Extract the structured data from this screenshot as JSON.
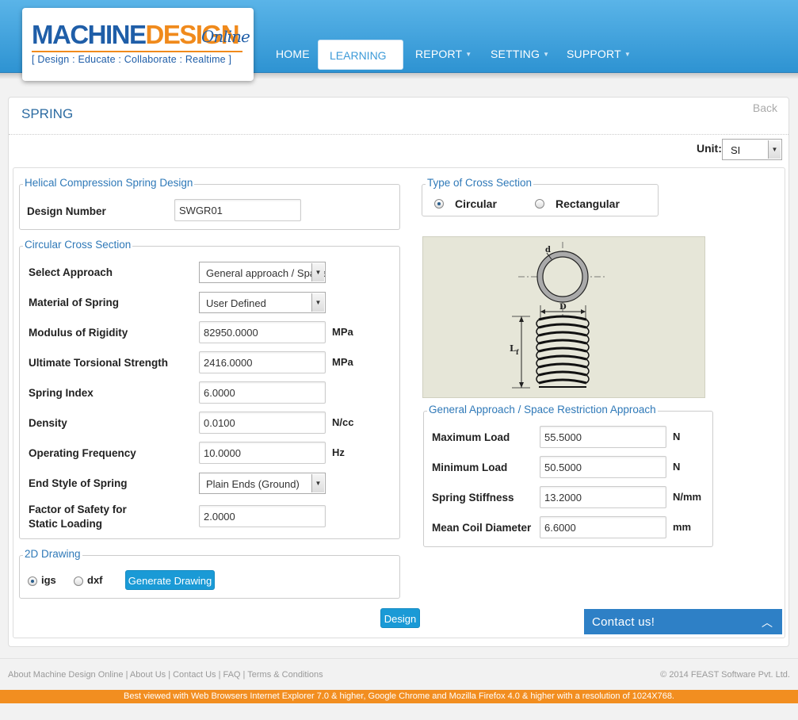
{
  "logo": {
    "main_part1": "MACHINE",
    "main_part2": "DESIGN",
    "suffix": "Online",
    "tagline": "[ Design : Educate : Collaborate : Realtime ]"
  },
  "nav": {
    "items": [
      {
        "label": "HOME",
        "has_dropdown": false
      },
      {
        "label": "LEARNING",
        "has_dropdown": false,
        "active": true
      },
      {
        "label": "REPORT",
        "has_dropdown": true
      },
      {
        "label": "SETTING",
        "has_dropdown": true
      },
      {
        "label": "SUPPORT",
        "has_dropdown": true
      }
    ],
    "caret_icon": "chevron-down-icon"
  },
  "page": {
    "title": "SPRING",
    "back": "Back",
    "unit_label": "Unit:",
    "unit_value": "SI"
  },
  "design_block": {
    "legend": "Helical Compression Spring Design",
    "design_number_label": "Design Number",
    "design_number_value": "SWGR01"
  },
  "circular": {
    "legend": "Circular Cross Section",
    "approach_label": "Select Approach",
    "approach_value": "General approach / Space Restriction Approach",
    "material_label": "Material of Spring",
    "material_value": "User Defined",
    "modulus_label": "Modulus of Rigidity",
    "modulus_value": "82950.0000",
    "modulus_unit": "MPa",
    "uts_label": "Ultimate Torsional Strength",
    "uts_value": "2416.0000",
    "uts_unit": "MPa",
    "index_label": "Spring Index",
    "index_value": "6.0000",
    "density_label": "Density",
    "density_value": "0.0100",
    "density_unit": "N/cc",
    "freq_label": "Operating Frequency",
    "freq_value": "10.0000",
    "freq_unit": "Hz",
    "end_label": "End Style of Spring",
    "end_value": "Plain Ends (Ground)",
    "fos_label_1": "Factor of Safety for",
    "fos_label_2": "Static Loading",
    "fos_value": "2.0000"
  },
  "drawing": {
    "legend": "2D Drawing",
    "opt_igs": "igs",
    "opt_dxf": "dxf",
    "selected": "igs",
    "generate_label": "Generate Drawing"
  },
  "cross_section": {
    "legend": "Type of Cross Section",
    "opt_circular": "Circular",
    "opt_rectangular": "Rectangular",
    "selected": "Circular"
  },
  "diagram": {
    "label_d": "d",
    "label_D": "D",
    "label_L": "L",
    "label_f": "f"
  },
  "general": {
    "legend": "General Approach / Space Restriction Approach",
    "max_label": "Maximum Load",
    "max_value": "55.5000",
    "max_unit": "N",
    "min_label": "Minimum Load",
    "min_value": "50.5000",
    "min_unit": "N",
    "stiff_label": "Spring Stiffness",
    "stiff_value": "13.2000",
    "stiff_unit": "N/mm",
    "dia_label": "Mean Coil Diameter",
    "dia_value": "6.6000",
    "dia_unit": "mm"
  },
  "design_button": "Design",
  "contact": {
    "label": "Contact us!",
    "icon": "chevron-up-icon"
  },
  "footer": {
    "links": "About Machine Design Online | About Us | Contact Us | FAQ | Terms & Conditions",
    "copyright": "© 2014 FEAST Software Pvt. Ltd.",
    "notice": "Best viewed with Web Browsers Internet Explorer 7.0 & higher, Google Chrome and Mozilla Firefox 4.0 & higher with a resolution of 1024X768."
  },
  "colors": {
    "header_blue": "#2e93d2",
    "accent_orange": "#f28e20",
    "legend_blue": "#2f79b8",
    "button_blue": "#1a9ad6"
  }
}
